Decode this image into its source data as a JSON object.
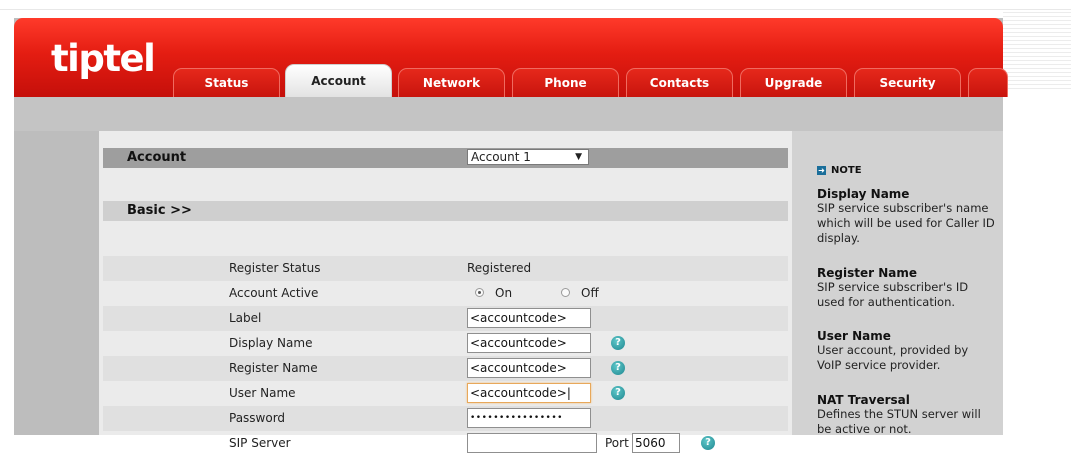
{
  "brand": {
    "logo": "tiptel"
  },
  "tabs": [
    {
      "label": "Status"
    },
    {
      "label": "Account"
    },
    {
      "label": "Network"
    },
    {
      "label": "Phone"
    },
    {
      "label": "Contacts"
    },
    {
      "label": "Upgrade"
    },
    {
      "label": "Security"
    }
  ],
  "active_tab": "Account",
  "account_section": {
    "title": "Account",
    "selected": "Account 1"
  },
  "basic_section": {
    "title": "Basic >>"
  },
  "fields": {
    "register_status": {
      "label": "Register Status",
      "value": "Registered"
    },
    "account_active": {
      "label": "Account Active",
      "on_label": "On",
      "off_label": "Off",
      "selected": "On"
    },
    "label": {
      "label": "Label",
      "value": "<accountcode>"
    },
    "display_name": {
      "label": "Display Name",
      "value": "<accountcode>"
    },
    "register_name": {
      "label": "Register Name",
      "value": "<accountcode>"
    },
    "user_name": {
      "label": "User Name",
      "value": "<accountcode>|"
    },
    "password": {
      "label": "Password",
      "value": "••••••••••••••••"
    },
    "sip_server": {
      "label": "SIP Server",
      "value": "",
      "port_label": "Port",
      "port_value": "5060"
    }
  },
  "help_icon": "?",
  "note": {
    "heading": "NOTE",
    "items": [
      {
        "title": "Display Name",
        "text": "SIP service subscriber's name which will be used for Caller ID display."
      },
      {
        "title": "Register Name",
        "text": "SIP service subscriber's ID used for authentication."
      },
      {
        "title": "User Name",
        "text": "User account, provided by VoIP service provider."
      },
      {
        "title": "NAT Traversal",
        "text": "Defines the STUN server will be active or not."
      }
    ]
  },
  "colors": {
    "brand_red": "#e41d12",
    "panel_bg": "#ebebeb",
    "help_teal": "#1f8790"
  }
}
